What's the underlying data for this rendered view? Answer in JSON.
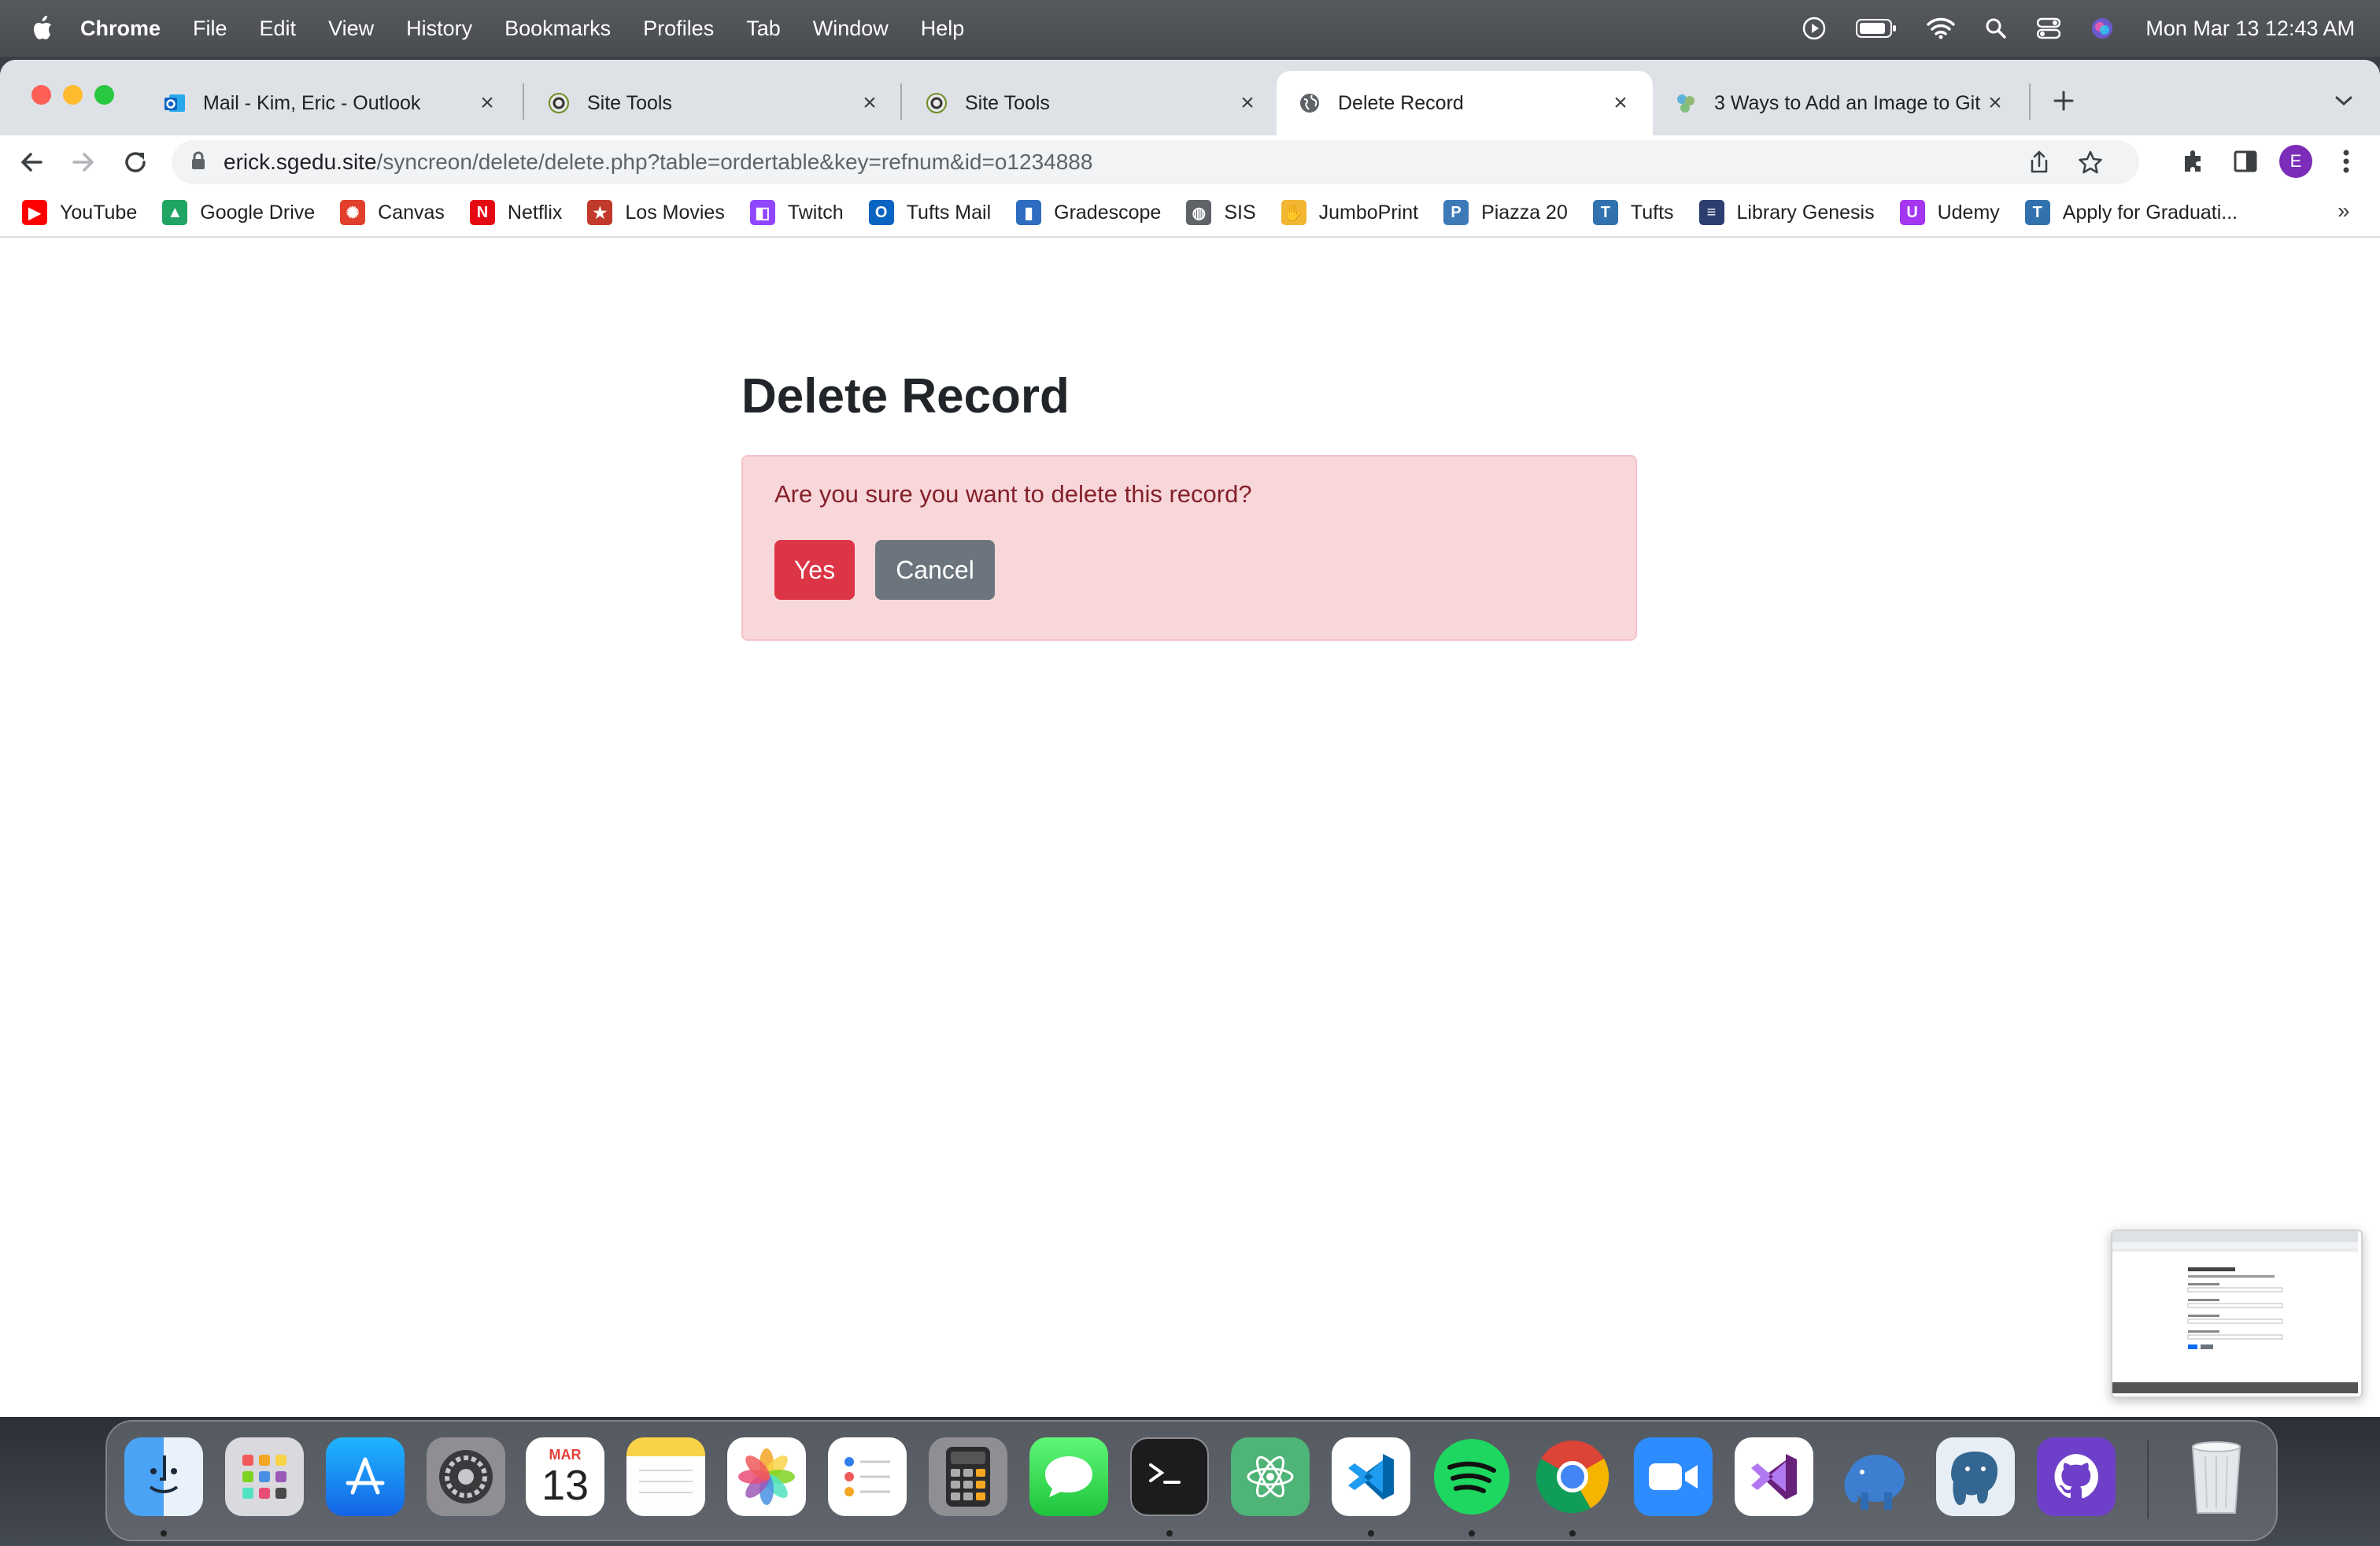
{
  "menubar": {
    "app": "Chrome",
    "items": [
      "File",
      "Edit",
      "View",
      "History",
      "Bookmarks",
      "Profiles",
      "Tab",
      "Window",
      "Help"
    ],
    "clock": "Mon Mar 13  12:43 AM"
  },
  "tabs": [
    {
      "title": "Mail - Kim, Eric - Outlook",
      "icon": "outlook-icon"
    },
    {
      "title": "Site Tools",
      "icon": "site-tools-icon"
    },
    {
      "title": "Site Tools",
      "icon": "site-tools-icon"
    },
    {
      "title": "Delete Record",
      "icon": "globe-icon",
      "active": true
    },
    {
      "title": "3 Ways to Add an Image to Git",
      "icon": "wikihow-icon"
    }
  ],
  "omnibox": {
    "host": "erick.sgedu.site",
    "path": "/syncreon/delete/delete.php?table=ordertable&key=refnum&id=o1234888"
  },
  "profile_initial": "E",
  "bookmarks": [
    {
      "label": "YouTube",
      "icon": "youtube-icon",
      "color": "#ff0000"
    },
    {
      "label": "Google Drive",
      "icon": "google-drive-icon",
      "color": "#1fa463"
    },
    {
      "label": "Canvas",
      "icon": "canvas-icon",
      "color": "#e13f2b"
    },
    {
      "label": "Netflix",
      "icon": "netflix-icon",
      "color": "#e50914"
    },
    {
      "label": "Los Movies",
      "icon": "star-icon",
      "color": "#c0392b"
    },
    {
      "label": "Twitch",
      "icon": "twitch-icon",
      "color": "#9146ff"
    },
    {
      "label": "Tufts Mail",
      "icon": "outlook-icon",
      "color": "#0a64c2"
    },
    {
      "label": "Gradescope",
      "icon": "bar-chart-icon",
      "color": "#2d6cc0"
    },
    {
      "label": "SIS",
      "icon": "globe-icon",
      "color": "#5f6368"
    },
    {
      "label": "JumboPrint",
      "icon": "hand-icon",
      "color": "#f2b632"
    },
    {
      "label": "Piazza 20",
      "icon": "piazza-icon",
      "color": "#3e7ab8"
    },
    {
      "label": "Tufts",
      "icon": "tufts-icon",
      "color": "#3172ae"
    },
    {
      "label": "Library Genesis",
      "icon": "library-icon",
      "color": "#2c3e70"
    },
    {
      "label": "Udemy",
      "icon": "udemy-icon",
      "color": "#a435f0"
    },
    {
      "label": "Apply for Graduati...",
      "icon": "tufts-icon",
      "color": "#3172ae"
    }
  ],
  "page": {
    "heading": "Delete Record",
    "message": "Are you sure you want to delete this record?",
    "yes_label": "Yes",
    "cancel_label": "Cancel",
    "colors": {
      "danger": "#dc3545",
      "secondary": "#6c757d",
      "alert_bg": "#f8d7da",
      "alert_text": "#842029"
    }
  },
  "dock": {
    "apps": [
      "finder-icon",
      "launchpad-icon",
      "app-store-icon",
      "system-settings-icon",
      "calendar-icon",
      "notes-icon",
      "photos-icon",
      "reminders-icon",
      "calculator-icon",
      "messages-icon",
      "terminal-icon",
      "atom-icon",
      "vscode-icon",
      "spotify-icon",
      "chrome-icon",
      "zoom-icon",
      "visual-studio-icon",
      "elephant-icon",
      "postgresql-icon",
      "github-desktop-icon"
    ],
    "calendar_month": "MAR",
    "calendar_day": "13",
    "trash": "trash-icon"
  }
}
